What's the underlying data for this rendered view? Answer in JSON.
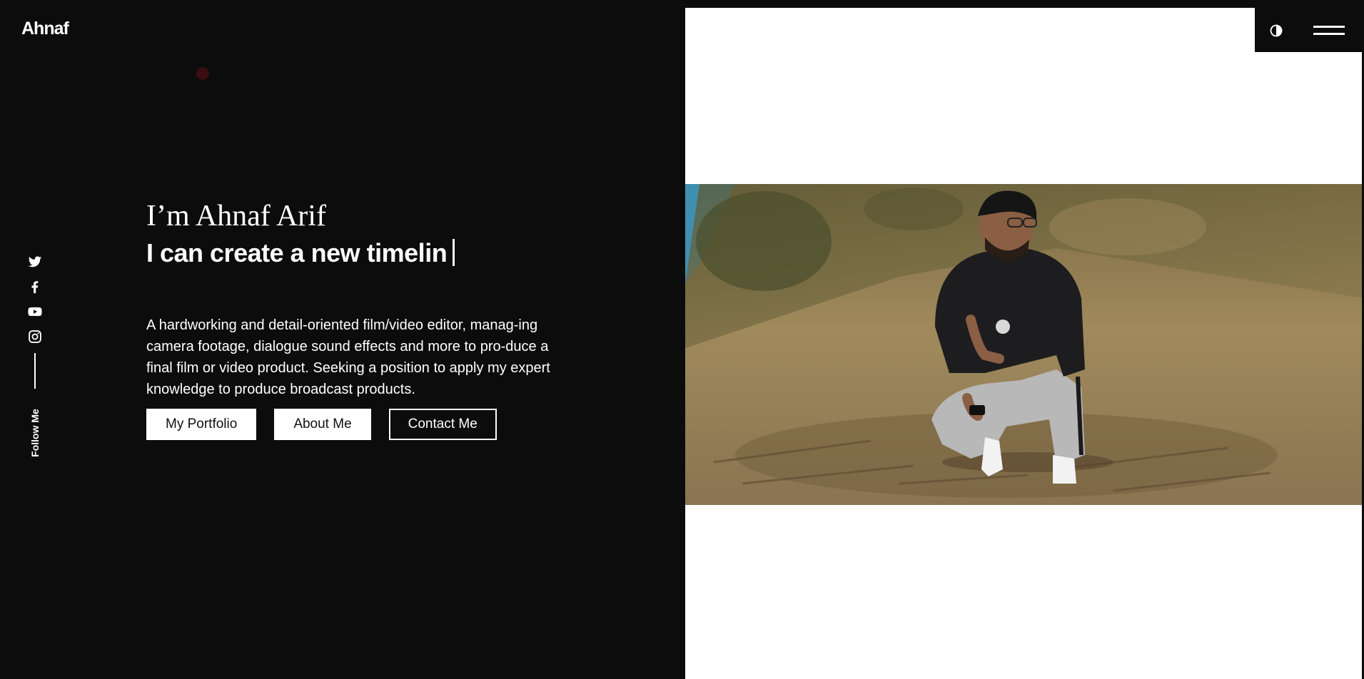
{
  "header": {
    "logo": "Ahnaf",
    "theme_toggle_icon": "contrast-icon",
    "menu_icon": "hamburger-menu-icon"
  },
  "social": {
    "items": [
      {
        "name": "twitter",
        "icon": "twitter-icon"
      },
      {
        "name": "facebook",
        "icon": "facebook-icon"
      },
      {
        "name": "youtube",
        "icon": "youtube-icon"
      },
      {
        "name": "instagram",
        "icon": "instagram-icon"
      }
    ],
    "follow_label": "Follow Me"
  },
  "hero": {
    "intro": "I’m Ahnaf Arif",
    "typed_text": "I can create a new timelin",
    "description": "A hardworking and detail-oriented film/video editor, manag-ing camera footage, dialogue sound effects and more to pro-duce a final film or video product. Seeking a position to apply my expert knowledge to produce broadcast products.",
    "buttons": {
      "portfolio": "My Portfolio",
      "about": "About Me",
      "contact": "Contact Me"
    }
  },
  "colors": {
    "background": "#0c0c0d",
    "text": "#ffffff",
    "panel": "#ffffff",
    "cursor_dot": "#3a0d10"
  }
}
